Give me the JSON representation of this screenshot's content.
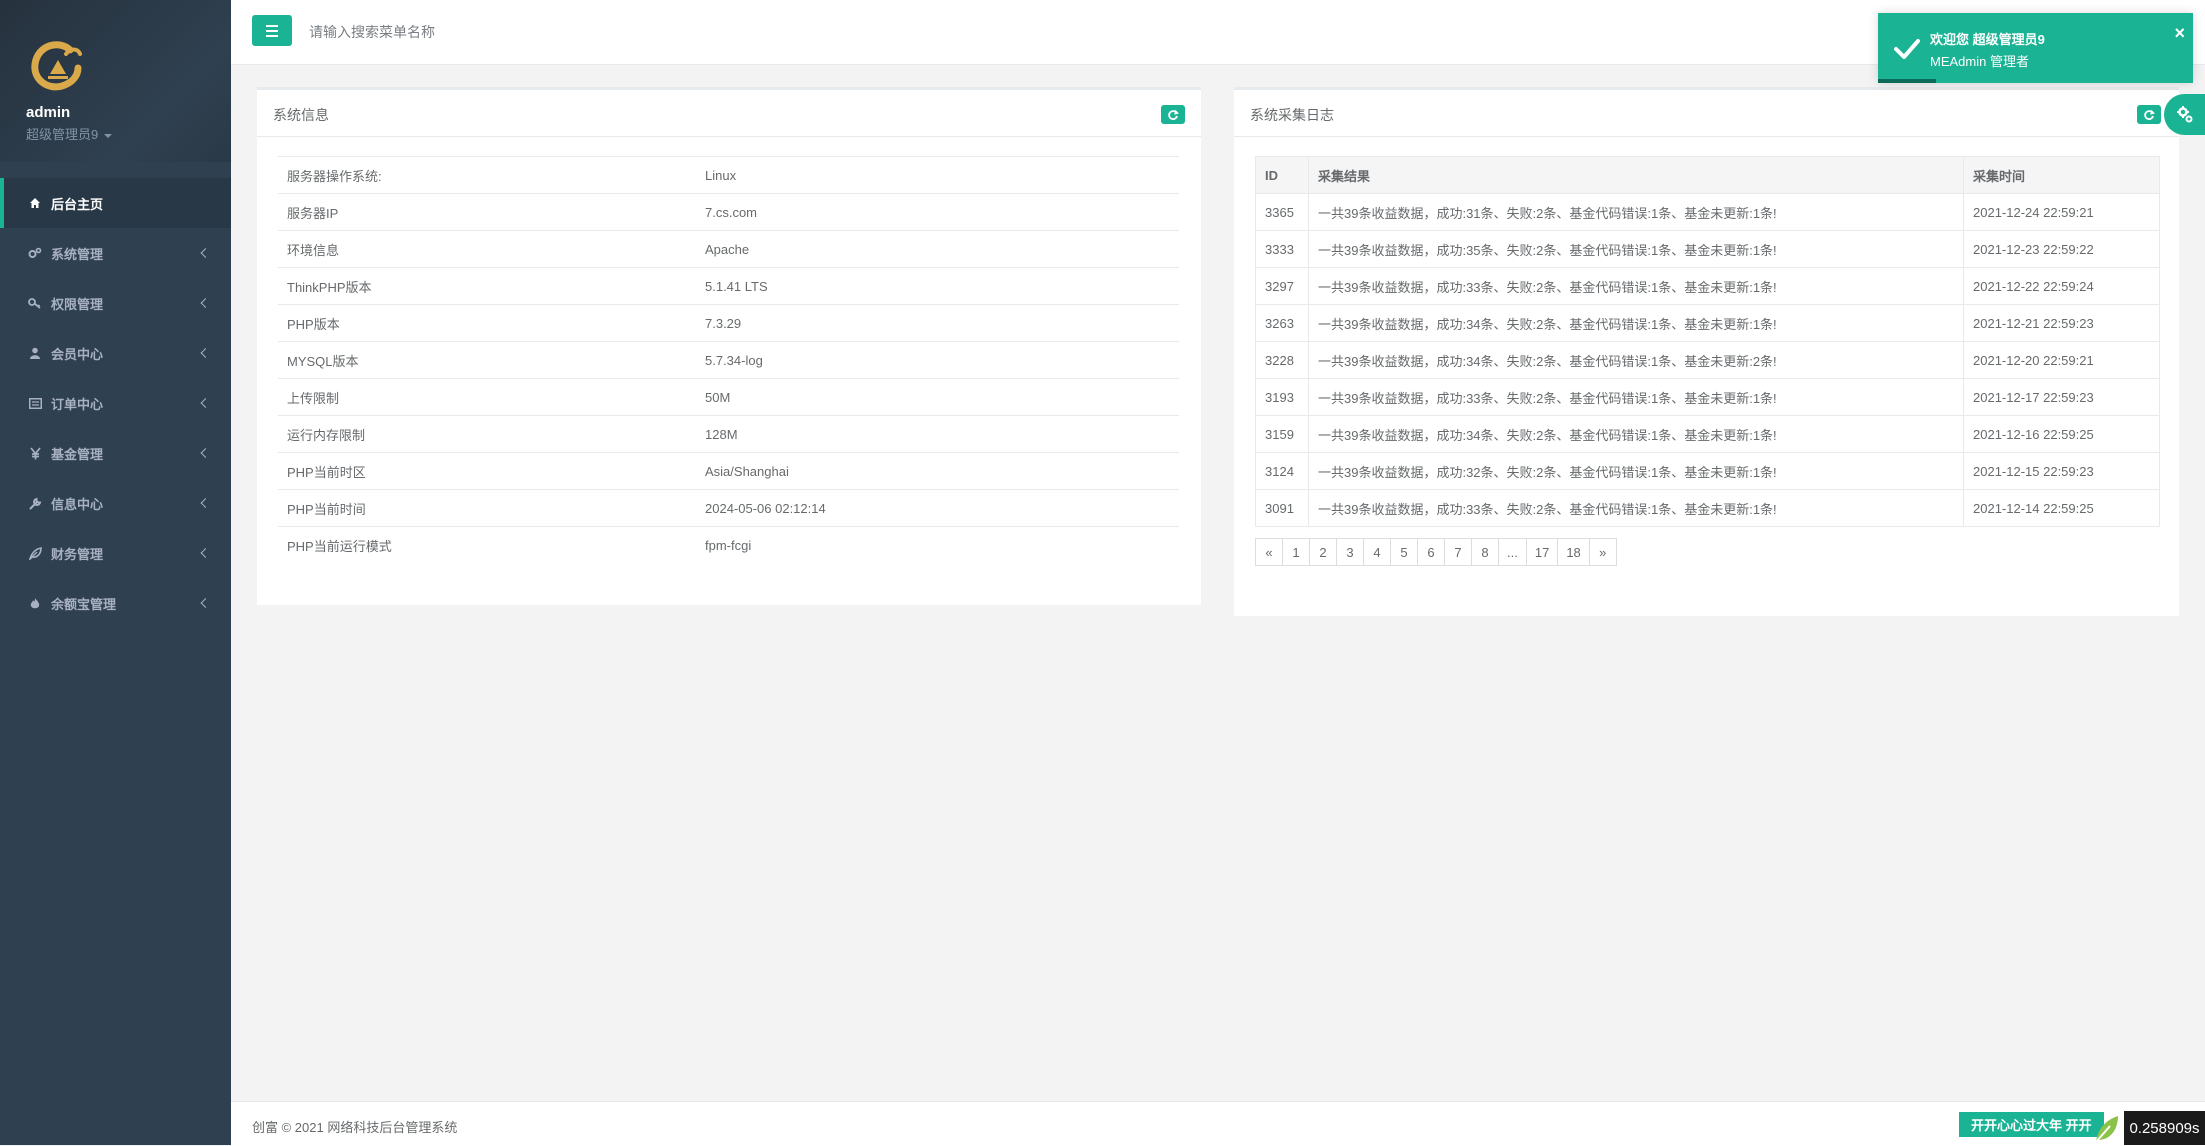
{
  "sidebar": {
    "user_name": "admin",
    "user_role": "超级管理员9",
    "items": [
      {
        "label": "后台主页",
        "icon": "home-icon",
        "active": true
      },
      {
        "label": "系统管理",
        "icon": "cogs-icon"
      },
      {
        "label": "权限管理",
        "icon": "key-icon"
      },
      {
        "label": "会员中心",
        "icon": "user-icon"
      },
      {
        "label": "订单中心",
        "icon": "list-icon"
      },
      {
        "label": "基金管理",
        "icon": "yen-icon"
      },
      {
        "label": "信息中心",
        "icon": "wrench-icon"
      },
      {
        "label": "财务管理",
        "icon": "leaf-icon"
      },
      {
        "label": "余额宝管理",
        "icon": "fire-icon"
      }
    ]
  },
  "topbar": {
    "search_placeholder": "请输入搜索菜单名称"
  },
  "toast": {
    "title": "欢迎您 超级管理员9",
    "message": "MEAdmin 管理者",
    "close": "×"
  },
  "system_info": {
    "title": "系统信息",
    "rows": [
      {
        "label": "服务器操作系统:",
        "value": "Linux"
      },
      {
        "label": "服务器IP",
        "value": "7.cs.com"
      },
      {
        "label": "环境信息",
        "value": "Apache"
      },
      {
        "label": "ThinkPHP版本",
        "value": "5.1.41 LTS"
      },
      {
        "label": "PHP版本",
        "value": "7.3.29"
      },
      {
        "label": "MYSQL版本",
        "value": "5.7.34-log"
      },
      {
        "label": "上传限制",
        "value": "50M"
      },
      {
        "label": "运行内存限制",
        "value": "128M"
      },
      {
        "label": "PHP当前时区",
        "value": "Asia/Shanghai"
      },
      {
        "label": "PHP当前时间",
        "value": "2024-05-06 02:12:14"
      },
      {
        "label": "PHP当前运行模式",
        "value": "fpm-fcgi"
      }
    ]
  },
  "collect_log": {
    "title": "系统采集日志",
    "columns": [
      "ID",
      "采集结果",
      "采集时间"
    ],
    "rows": [
      {
        "id": "3365",
        "result": "一共39条收益数据，成功:31条、失败:2条、基金代码错误:1条、基金未更新:1条!",
        "time": "2021-12-24 22:59:21"
      },
      {
        "id": "3333",
        "result": "一共39条收益数据，成功:35条、失败:2条、基金代码错误:1条、基金未更新:1条!",
        "time": "2021-12-23 22:59:22"
      },
      {
        "id": "3297",
        "result": "一共39条收益数据，成功:33条、失败:2条、基金代码错误:1条、基金未更新:1条!",
        "time": "2021-12-22 22:59:24"
      },
      {
        "id": "3263",
        "result": "一共39条收益数据，成功:34条、失败:2条、基金代码错误:1条、基金未更新:1条!",
        "time": "2021-12-21 22:59:23"
      },
      {
        "id": "3228",
        "result": "一共39条收益数据，成功:34条、失败:2条、基金代码错误:1条、基金未更新:2条!",
        "time": "2021-12-20 22:59:21"
      },
      {
        "id": "3193",
        "result": "一共39条收益数据，成功:33条、失败:2条、基金代码错误:1条、基金未更新:1条!",
        "time": "2021-12-17 22:59:23"
      },
      {
        "id": "3159",
        "result": "一共39条收益数据，成功:34条、失败:2条、基金代码错误:1条、基金未更新:1条!",
        "time": "2021-12-16 22:59:25"
      },
      {
        "id": "3124",
        "result": "一共39条收益数据，成功:32条、失败:2条、基金代码错误:1条、基金未更新:1条!",
        "time": "2021-12-15 22:59:23"
      },
      {
        "id": "3091",
        "result": "一共39条收益数据，成功:33条、失败:2条、基金代码错误:1条、基金未更新:1条!",
        "time": "2021-12-14 22:59:25"
      }
    ],
    "pagination": [
      "«",
      "1",
      "2",
      "3",
      "4",
      "5",
      "6",
      "7",
      "8",
      "...",
      "17",
      "18",
      "»"
    ]
  },
  "footer": {
    "text": "创富 © 2021 网络科技后台管理系统",
    "badge": "开开心心过大年 开开",
    "timer": "0.258909s"
  },
  "colors": {
    "primary": "#1ab394",
    "sidebar": "#2f4050"
  }
}
